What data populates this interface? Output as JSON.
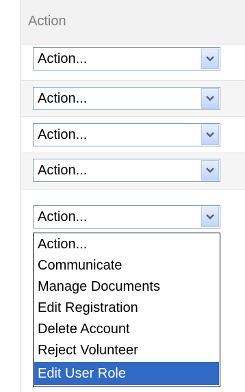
{
  "table": {
    "column_header": "Action"
  },
  "rows": [
    {
      "select_value": "Action..."
    },
    {
      "select_value": "Action..."
    },
    {
      "select_value": "Action..."
    },
    {
      "select_value": "Action..."
    },
    {
      "select_value": "Action..."
    }
  ],
  "dropdown": {
    "options": [
      "Action...",
      "Communicate",
      "Manage Documents",
      "Edit Registration",
      "Delete Account",
      "Reject Volunteer",
      "Edit User Role"
    ],
    "highlighted_option": "Edit User Role"
  },
  "colors": {
    "select_border": "#7f9db9",
    "highlight": "#316ac5",
    "header_bg": "#f2f2f2"
  },
  "icons": {
    "select_arrow": "chevron-down-icon"
  }
}
